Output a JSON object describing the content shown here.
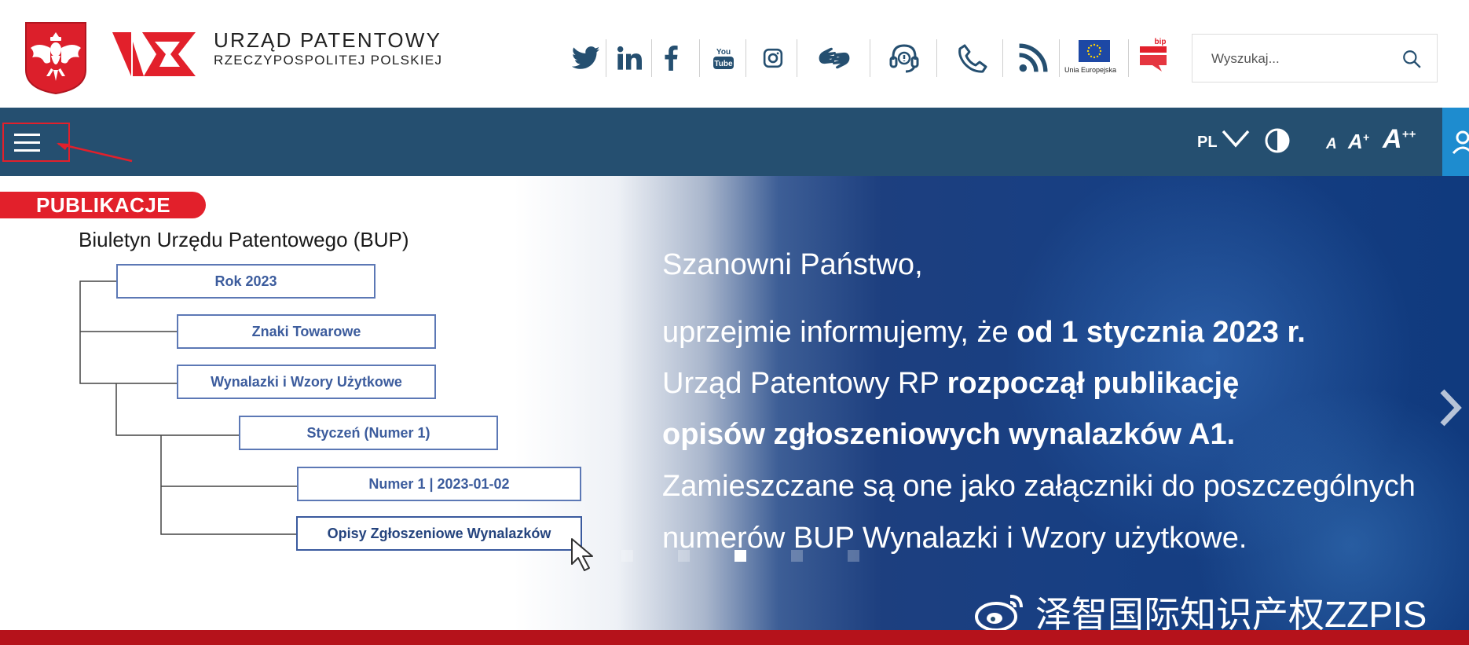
{
  "header": {
    "brand_line1": "URZĄD PATENTOWY",
    "brand_line2": "RZECZYPOSPOLITEJ POLSKIEJ",
    "social_icons": [
      "twitter-icon",
      "linkedin-icon",
      "facebook-icon",
      "youtube-icon",
      "instagram-icon",
      "sign-language-icon",
      "headset-icon",
      "phone-icon",
      "rss-icon",
      "eu-flag-icon",
      "bip-icon"
    ],
    "youtube_text_1": "You",
    "youtube_text_2": "Tube",
    "eu_label": "Unia Europejska",
    "bip_label": "bip",
    "search": {
      "placeholder": "Wyszukaj..."
    }
  },
  "navbar": {
    "language": "PL",
    "font_small": "A",
    "font_medium": "A",
    "font_medium_sup": "+",
    "font_large": "A",
    "font_large_sup": "++"
  },
  "hero": {
    "tag": "PUBLIKACJE",
    "bup_title": "Biuletyn Urzędu Patentowego (BUP)",
    "tree": [
      "Rok 2023",
      "Znaki Towarowe",
      "Wynalazki i Wzory Użytkowe",
      "Styczeń (Numer 1)",
      "Numer 1 | 2023-01-02",
      "Opisy Zgłoszeniowe Wynalazków"
    ],
    "greeting": "Szanowni Państwo,",
    "line1_normal": "uprzejmie informujemy, że ",
    "line1_bold": "od 1 stycznia 2023 r.",
    "line2_normal": "Urząd Patentowy RP ",
    "line2_bold": "rozpoczął publikację",
    "line3_bold": "opisów zgłoszeniowych wynalazków A1.",
    "line4": "Zamieszczane są one jako załączniki do poszczególnych",
    "line5": "numerów BUP Wynalazki i Wzory użytkowe.",
    "slides_count": 5,
    "active_slide": 3,
    "watermark": "泽智国际知识产权ZZPIS"
  },
  "colors": {
    "navbar": "#254f70",
    "accent_red": "#e2202b",
    "accessibility_blue": "#1e8ccf",
    "footer_red": "#b5121b"
  }
}
